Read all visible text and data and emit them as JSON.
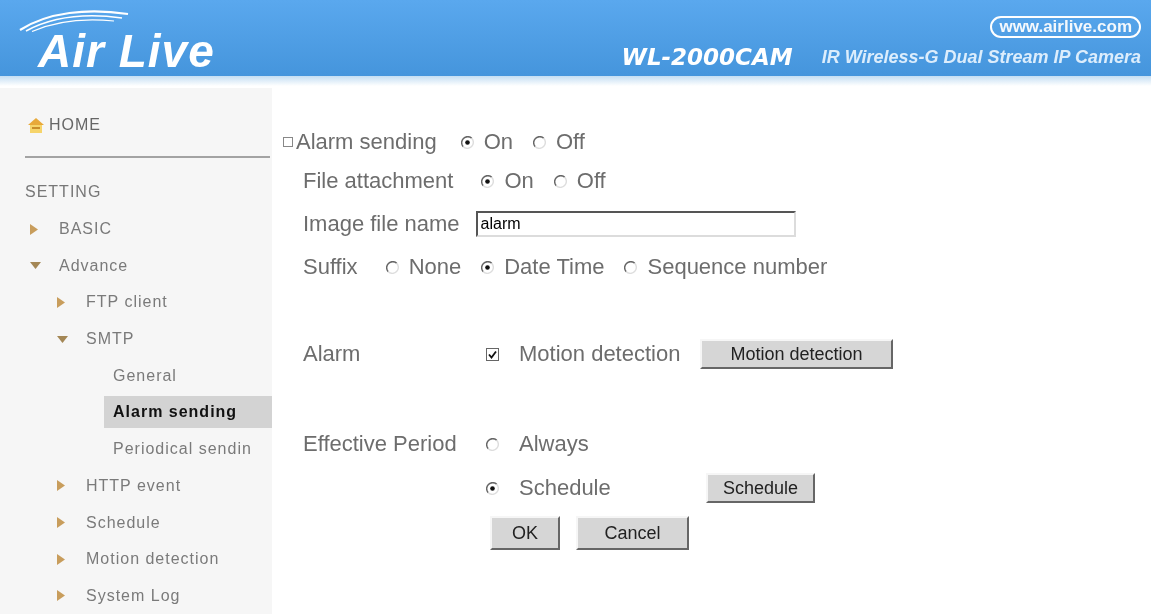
{
  "header": {
    "logo": "Air Live",
    "website": "www.airlive.com",
    "model": "WL-2000CAM",
    "product": "IR Wireless-G Dual Stream IP Camera"
  },
  "sidebar": {
    "home": "HOME",
    "section": "SETTING",
    "items": [
      {
        "label": "BASIC",
        "expanded": false,
        "selected": false
      },
      {
        "label": "Advance",
        "expanded": true,
        "selected": false,
        "children": [
          {
            "label": "FTP client",
            "expanded": false,
            "selected": false
          },
          {
            "label": "SMTP",
            "expanded": true,
            "selected": false,
            "children": [
              {
                "label": "General",
                "selected": false
              },
              {
                "label": "Alarm sending",
                "selected": true
              },
              {
                "label": "Periodical sendin",
                "selected": false
              }
            ]
          },
          {
            "label": "HTTP event",
            "expanded": false,
            "selected": false
          },
          {
            "label": "Schedule",
            "expanded": false,
            "selected": false
          },
          {
            "label": "Motion detection",
            "expanded": false,
            "selected": false
          },
          {
            "label": "System Log",
            "expanded": false,
            "selected": false
          }
        ]
      }
    ]
  },
  "form": {
    "title": "Alarm sending",
    "title_options": [
      {
        "label": "On",
        "selected": true
      },
      {
        "label": "Off",
        "selected": false
      }
    ],
    "fields": [
      {
        "kind": "radio",
        "label": "File attachment",
        "options": [
          {
            "label": "On",
            "selected": true
          },
          {
            "label": "Off",
            "selected": false
          }
        ]
      },
      {
        "kind": "text",
        "label": "Image file name",
        "value": "alarm"
      },
      {
        "kind": "radio",
        "label": "Suffix",
        "options": [
          {
            "label": "None",
            "selected": false
          },
          {
            "label": "Date Time",
            "selected": true
          },
          {
            "label": "Sequence number",
            "selected": false
          }
        ]
      }
    ],
    "alarm": {
      "label": "Alarm",
      "option": {
        "label": "Motion detection",
        "checked": true
      },
      "button": "Motion detection"
    },
    "effective_period": {
      "label": "Effective Period",
      "options": [
        {
          "label": "Always",
          "selected": false
        },
        {
          "label": "Schedule",
          "selected": true,
          "button": "Schedule"
        }
      ]
    },
    "buttons": [
      "OK",
      "Cancel"
    ]
  }
}
